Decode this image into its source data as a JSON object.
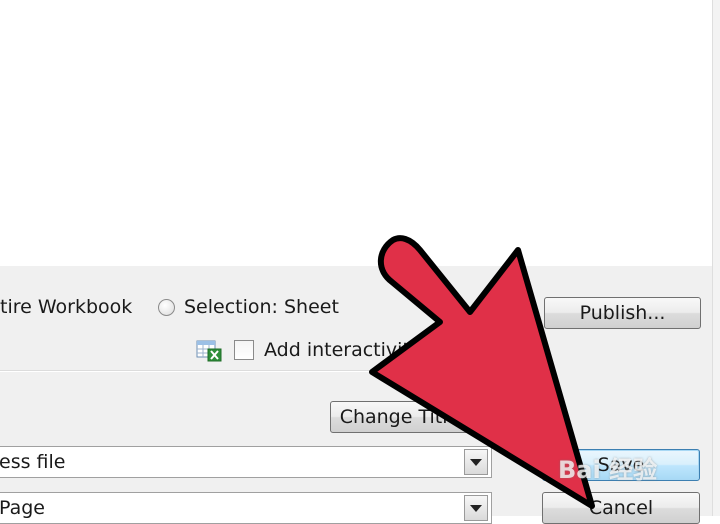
{
  "dialog": {
    "radio_entire_workbook": "tire Workbook",
    "radio_selection": "Selection: Sheet",
    "checkbox_interactivity": "Add interactivity",
    "buttons": {
      "publish": "Publish...",
      "change_title": "Change Title...",
      "save": "Save",
      "cancel": "Cancel"
    },
    "combo_file_type": "ess file",
    "combo_page": "Page"
  },
  "overlay": {
    "arrow_color": "#e03048",
    "watermark": "Bai 经验"
  }
}
